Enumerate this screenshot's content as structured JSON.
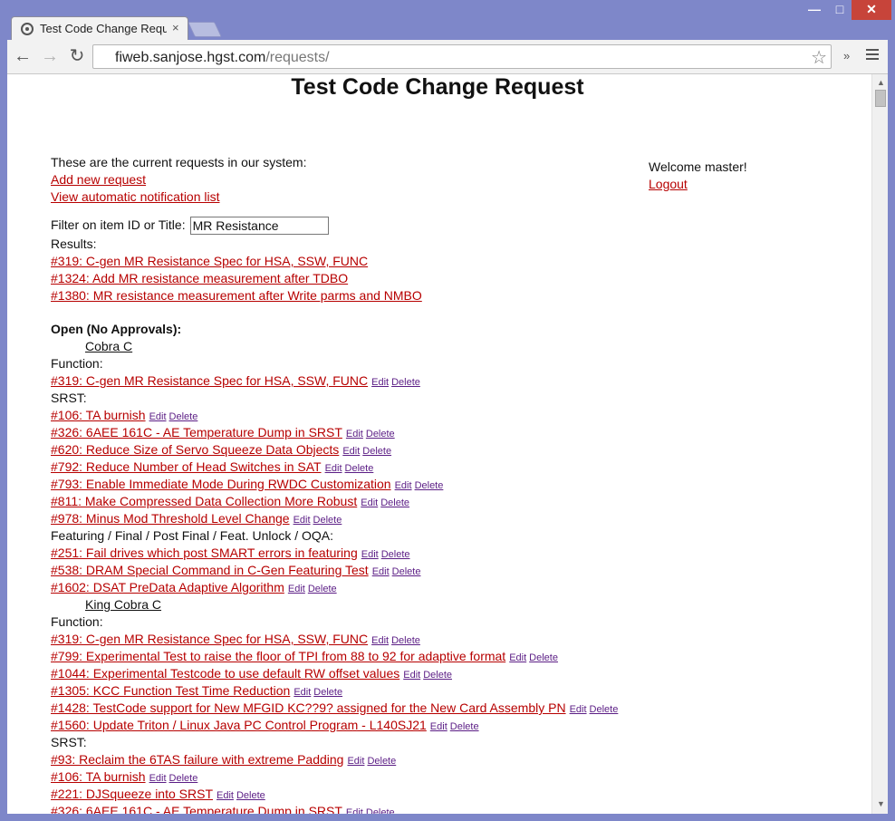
{
  "browser": {
    "tab_title": "Test Code Change Reques",
    "tab_close": "×",
    "window_minimize": "—",
    "window_maximize": "□",
    "window_close": "✕",
    "back": "←",
    "forward": "→",
    "reload": "↻",
    "url_host": "fiweb.sanjose.hgst.com",
    "url_path": "/requests/",
    "extensions": "»"
  },
  "page": {
    "title": "Test Code Change Request",
    "intro": "These are the current requests in our system:",
    "add_new": "Add new request",
    "view_list": "View automatic notification list",
    "filter_label": "Filter on item ID or Title:",
    "filter_value": "MR Resistance",
    "results_label": "Results:",
    "results": [
      "#319: C-gen MR Resistance Spec for HSA, SSW, FUNC",
      "#1324: Add MR resistance measurement after TDBO",
      "#1380: MR resistance measurement after Write parms and NMBO"
    ],
    "welcome": "Welcome master!",
    "logout": "Logout",
    "open_heading": "Open (No Approvals):",
    "edit": "Edit",
    "delete": "Delete",
    "groups": [
      {
        "platform": "Cobra C",
        "sections": [
          {
            "name": "Function:",
            "items": [
              "#319: C-gen MR Resistance Spec for HSA, SSW, FUNC"
            ]
          },
          {
            "name": "SRST:",
            "items": [
              "#106: TA burnish",
              "#326: 6AEE 161C - AE Temperature Dump in SRST",
              "#620: Reduce Size of Servo Squeeze Data Objects",
              "#792: Reduce Number of Head Switches in SAT",
              "#793: Enable Immediate Mode During RWDC Customization",
              "#811: Make Compressed Data Collection More Robust",
              "#978: Minus Mod Threshold Level Change"
            ]
          },
          {
            "name": "Featuring / Final / Post Final / Feat. Unlock / OQA:",
            "items": [
              "#251: Fail drives which post SMART errors in featuring",
              "#538: DRAM Special Command in C-Gen Featuring Test",
              "#1602: DSAT PreData Adaptive Algorithm"
            ]
          }
        ]
      },
      {
        "platform": "King Cobra C",
        "sections": [
          {
            "name": "Function:",
            "items": [
              "#319: C-gen MR Resistance Spec for HSA, SSW, FUNC",
              "#799: Experimental Test to raise the floor of TPI from 88 to 92 for adaptive format",
              "#1044: Experimental Testcode to use default RW offset values",
              "#1305: KCC Function Test Time Reduction",
              "#1428: TestCode support for New MFGID KC??9? assigned for the New Card Assembly PN",
              "#1560: Update Triton / Linux Java PC Control Program - L140SJ21"
            ]
          },
          {
            "name": "SRST:",
            "items": [
              "#93: Reclaim the 6TAS failure with extreme Padding",
              "#106: TA burnish",
              "#221: DJSqueeze into SRST",
              "#326: 6AEE 161C - AE Temperature Dump in SRST"
            ]
          }
        ]
      }
    ]
  }
}
